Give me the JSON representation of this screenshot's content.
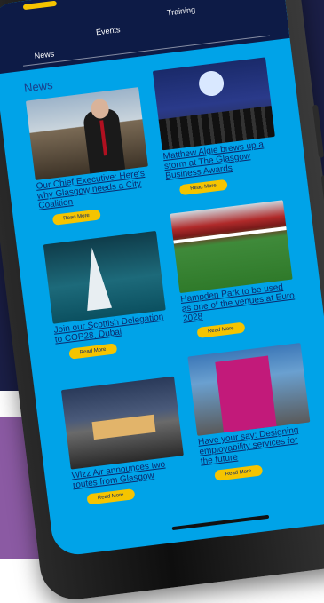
{
  "nav": {
    "tabs": [
      "News",
      "Events",
      "Training",
      ""
    ]
  },
  "section_title": "News",
  "articles": [
    {
      "title": "Our Chief Executive: Here's why Glasgow needs a City Coalition",
      "cta": "Read More"
    },
    {
      "title": "Matthew Algie brews up a storm at The Glasgow Business Awards",
      "cta": "Read More"
    },
    {
      "title": "Join our Scottish Delegation to COP28, Dubai",
      "cta": "Read More"
    },
    {
      "title": "Hampden Park to be used as one of the venues at Euro 2028",
      "cta": "Read More"
    },
    {
      "title": "Wizz Air announces two routes from Glasgow",
      "cta": "Read More"
    },
    {
      "title": "Have your say: Designing employability services for the future",
      "cta": "Read More"
    }
  ],
  "colors": {
    "screen_bg": "#00a3e8",
    "nav_bg": "#0d1b46",
    "accent": "#f5c400",
    "background_navy": "#1b1f47",
    "background_purple": "#8b5aa3"
  }
}
